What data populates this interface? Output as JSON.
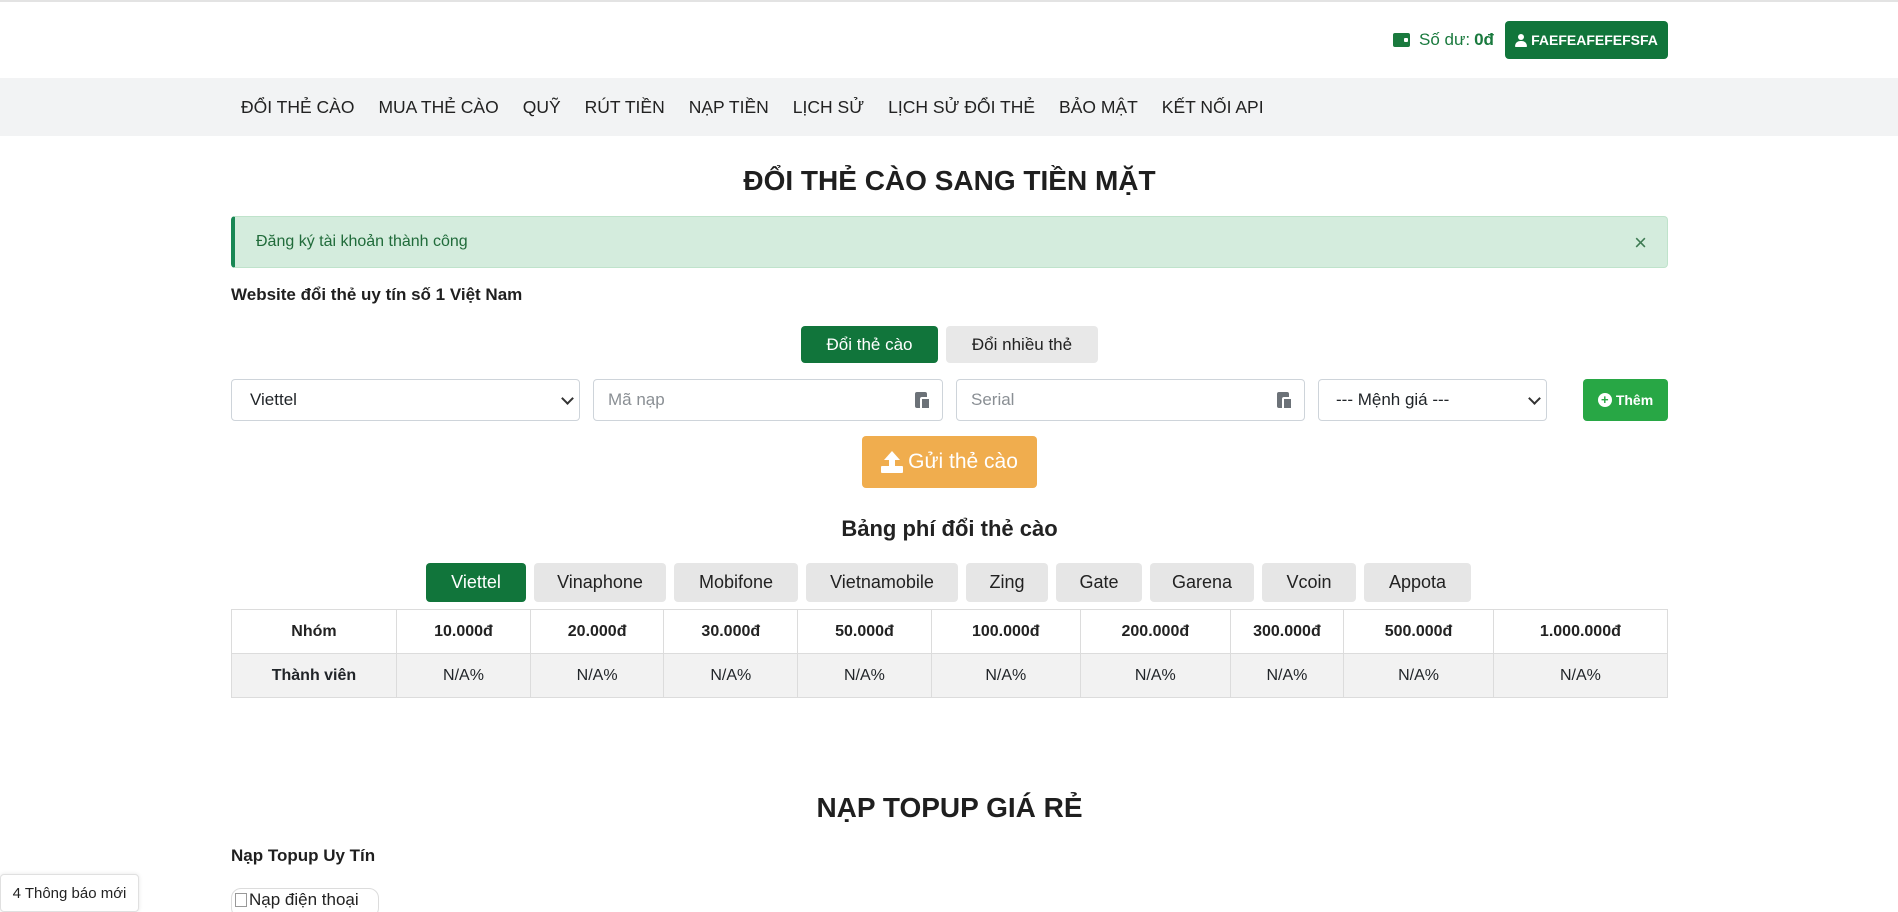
{
  "header": {
    "balance_label": "Số dư:",
    "balance_amount": "0đ",
    "user_button": "FAEFEAFEFEFSFA"
  },
  "nav": {
    "items": [
      {
        "label": "ĐỔI THẺ CÀO"
      },
      {
        "label": "MUA THẺ CÀO"
      },
      {
        "label": "QUỸ"
      },
      {
        "label": "RÚT TIỀN"
      },
      {
        "label": "NẠP TIỀN"
      },
      {
        "label": "LỊCH SỬ"
      },
      {
        "label": "LỊCH SỬ ĐỔI THẺ"
      },
      {
        "label": "BẢO MẬT"
      },
      {
        "label": "KẾT NỐI API"
      }
    ]
  },
  "main": {
    "title": "ĐỔI THẺ CÀO SANG TIỀN MẶT",
    "alert": "Đăng ký tài khoản thành công",
    "alert_close": "×",
    "subheading": "Website đổi thẻ uy tín số 1 Việt Nam",
    "tabs": {
      "single": "Đổi thẻ cào",
      "multi": "Đổi nhiều thẻ"
    },
    "form": {
      "provider_value": "Viettel",
      "code_placeholder": "Mã nạp",
      "serial_placeholder": "Serial",
      "amount_value": "--- Mệnh giá ---",
      "add_button": "Thêm",
      "submit_button": "Gửi thẻ cào"
    }
  },
  "fees": {
    "title": "Bảng phí đổi thẻ cào",
    "providers": [
      "Viettel",
      "Vinaphone",
      "Mobifone",
      "Vietnamobile",
      "Zing",
      "Gate",
      "Garena",
      "Vcoin",
      "Appota"
    ],
    "active_provider": "Viettel",
    "header": [
      "Nhóm",
      "10.000đ",
      "20.000đ",
      "30.000đ",
      "50.000đ",
      "100.000đ",
      "200.000đ",
      "300.000đ",
      "500.000đ",
      "1.000.000đ"
    ],
    "rows": [
      [
        "Thành viên",
        "N/A%",
        "N/A%",
        "N/A%",
        "N/A%",
        "N/A%",
        "N/A%",
        "N/A%",
        "N/A%",
        "N/A%"
      ]
    ]
  },
  "topup": {
    "title": "NẠP TOPUP GIÁ RẺ",
    "subheading": "Nạp Topup Uy Tín",
    "image_alt": "Nạp điện thoại"
  },
  "notification": "4 Thông báo mới",
  "colors": {
    "primary": "#11753b",
    "success": "#28a745",
    "warning": "#f0ad4e",
    "alert_bg": "#d4ecdd"
  }
}
